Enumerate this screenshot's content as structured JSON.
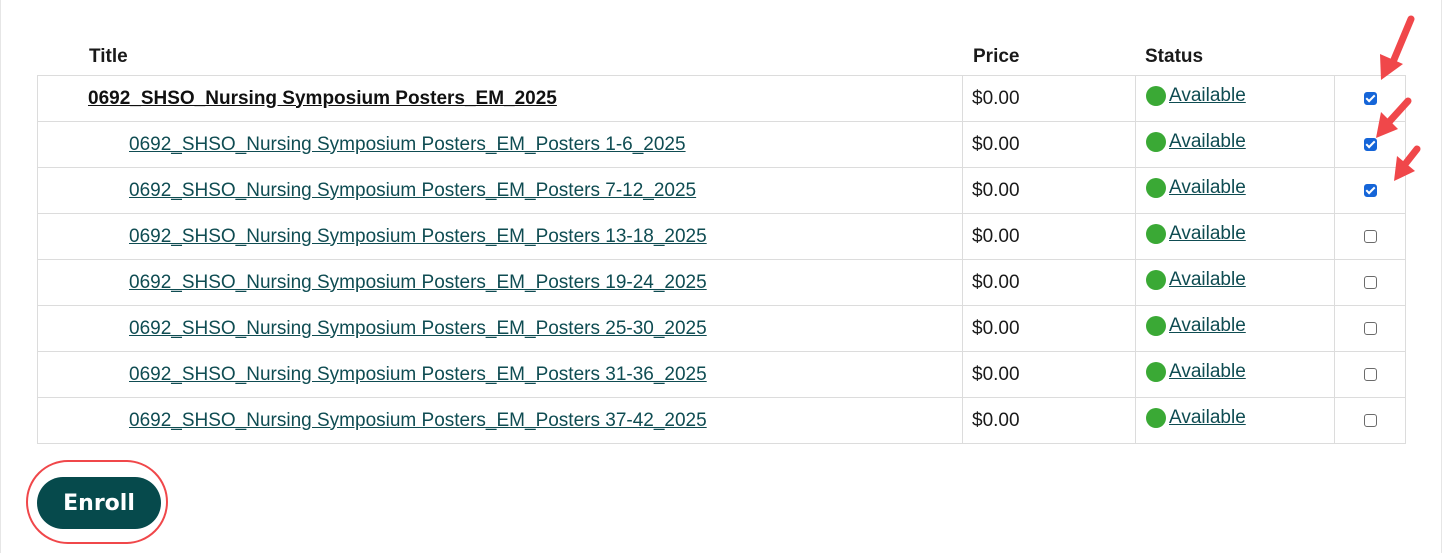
{
  "colors": {
    "accent": "#0f4c52",
    "enroll_bg": "#064a4c",
    "status_green": "#3aa935",
    "annotation_red": "#f0474a",
    "checkbox_blue": "#1565d8"
  },
  "table": {
    "headers": {
      "title": "Title",
      "price": "Price",
      "status": "Status"
    },
    "rows": [
      {
        "title": "0692_SHSO_Nursing Symposium Posters_EM_2025",
        "price": "$0.00",
        "status": "Available",
        "checked": true,
        "is_parent": true
      },
      {
        "title": "0692_SHSO_Nursing Symposium Posters_EM_Posters 1-6_2025",
        "price": "$0.00",
        "status": "Available",
        "checked": true,
        "is_parent": false
      },
      {
        "title": "0692_SHSO_Nursing Symposium Posters_EM_Posters 7-12_2025",
        "price": "$0.00",
        "status": "Available",
        "checked": true,
        "is_parent": false
      },
      {
        "title": "0692_SHSO_Nursing Symposium Posters_EM_Posters 13-18_2025",
        "price": "$0.00",
        "status": "Available",
        "checked": false,
        "is_parent": false
      },
      {
        "title": "0692_SHSO_Nursing Symposium Posters_EM_Posters 19-24_2025",
        "price": "$0.00",
        "status": "Available",
        "checked": false,
        "is_parent": false
      },
      {
        "title": "0692_SHSO_Nursing Symposium Posters_EM_Posters 25-30_2025",
        "price": "$0.00",
        "status": "Available",
        "checked": false,
        "is_parent": false
      },
      {
        "title": "0692_SHSO_Nursing Symposium Posters_EM_Posters 31-36_2025",
        "price": "$0.00",
        "status": "Available",
        "checked": false,
        "is_parent": false
      },
      {
        "title": "0692_SHSO_Nursing Symposium Posters_EM_Posters 37-42_2025",
        "price": "$0.00",
        "status": "Available",
        "checked": false,
        "is_parent": false
      }
    ]
  },
  "enroll_button": {
    "label": "Enroll"
  }
}
